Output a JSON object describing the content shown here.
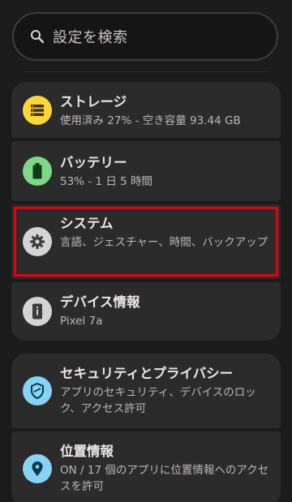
{
  "search": {
    "placeholder": "設定を検索"
  },
  "settings_items": [
    {
      "title": "ストレージ",
      "summary": "使用済み 27% - 空き容量 93.44 GB",
      "icon": "storage-icon",
      "icon_bg": "#fcd637"
    },
    {
      "title": "バッテリー",
      "summary": "53% - 1 日 5 時間",
      "icon": "battery-icon",
      "icon_bg": "#7ed88a"
    },
    {
      "title": "システム",
      "summary": "言語、ジェスチャー、時間、バックアップ",
      "icon": "gear-icon",
      "icon_bg": "#d4d4d4"
    },
    {
      "title": "デバイス情報",
      "summary": "Pixel 7a",
      "icon": "device-info-icon",
      "icon_bg": "#d4d4d4"
    },
    {
      "title": "セキュリティとプライバシー",
      "summary": "アプリのセキュリティ、デバイスのロック、アクセス許可",
      "icon": "security-shield-icon",
      "icon_bg": "#86d3f5"
    },
    {
      "title": "位置情報",
      "summary": "ON / 17 個のアプリに位置情報へのアクセスを許可",
      "icon": "location-pin-icon",
      "icon_bg": "#86d3f5"
    }
  ],
  "highlight_color": "#e8000b"
}
